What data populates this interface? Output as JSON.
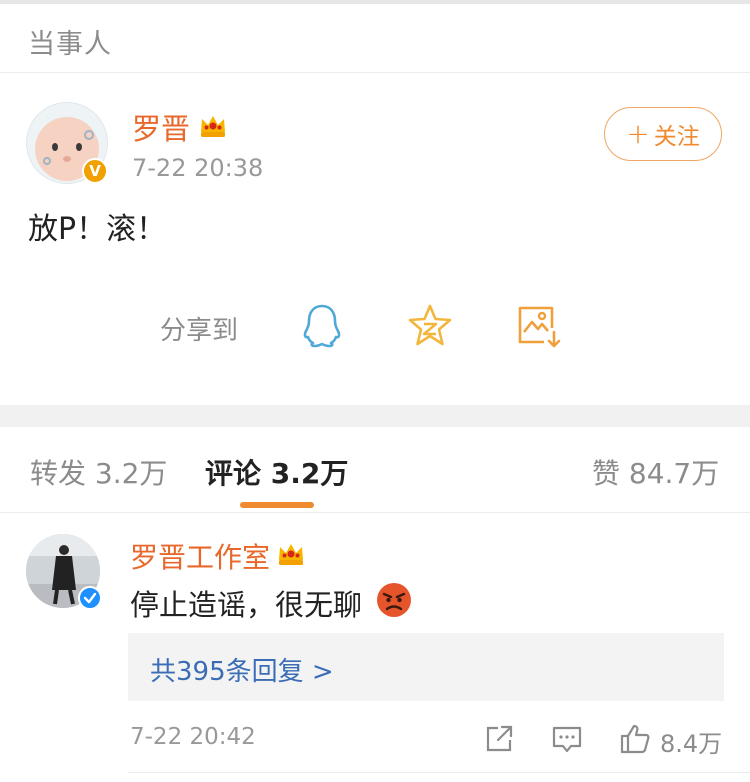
{
  "section": {
    "label": "当事人"
  },
  "post": {
    "author": "罗晋",
    "time": "7-22 20:38",
    "content": "放P！滚！",
    "follow_label": "关注",
    "follow_plus": "+",
    "vip_letter": "V"
  },
  "share": {
    "label": "分享到",
    "icons": [
      "qq-icon",
      "qzone-star-icon",
      "save-image-icon"
    ]
  },
  "tabs": {
    "repost": "转发 3.2万",
    "comment": "评论 3.2万",
    "like": "赞 84.7万"
  },
  "comment": {
    "author": "罗晋工作室",
    "text": "停止造谣，很无聊",
    "emoji": "angry-face-icon",
    "replies": "共395条回复 >",
    "time": "7-22 20:42",
    "likes": "8.4万"
  },
  "colors": {
    "name": "#e8682b",
    "accent": "#f08a2e",
    "link": "#3b6db6",
    "muted": "#999999"
  }
}
